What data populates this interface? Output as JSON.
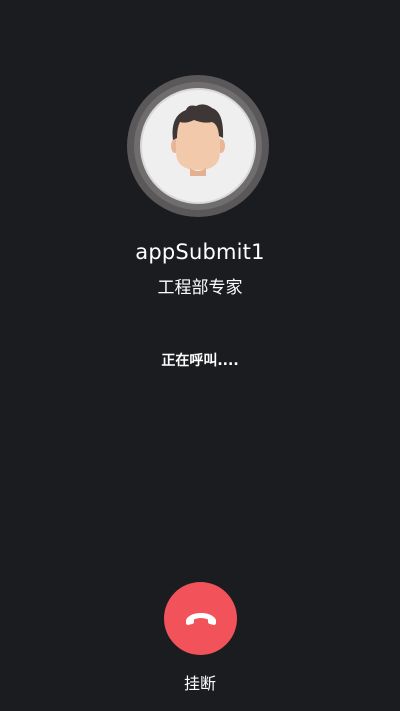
{
  "caller": {
    "name": "appSubmit1",
    "role": "工程部专家",
    "avatar_icon": "user-avatar-icon"
  },
  "call": {
    "status": "正在呼叫...."
  },
  "actions": {
    "hangup_label": "挂断",
    "hangup_icon": "phone-hangup-icon"
  },
  "colors": {
    "background": "#1b1c20",
    "hangup": "#f2525a",
    "ring": "#5a5859"
  }
}
